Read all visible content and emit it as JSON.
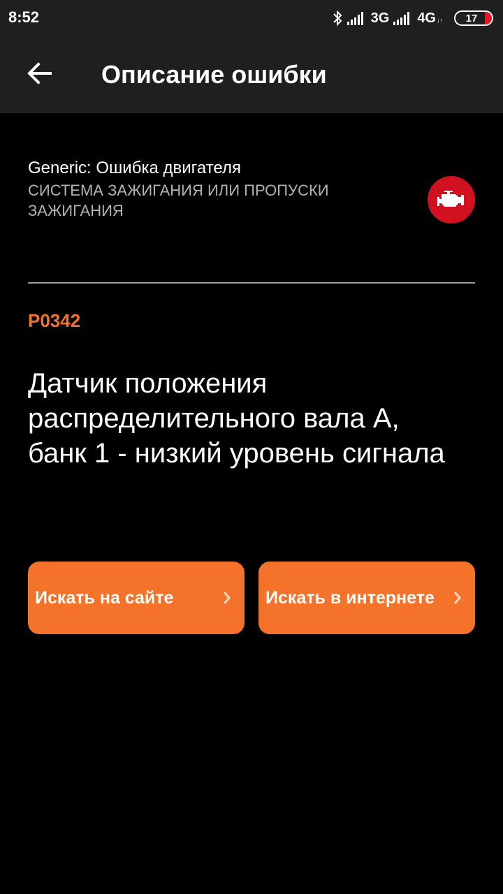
{
  "status_bar": {
    "time": "8:52",
    "network_1": "3G",
    "network_2": "4G",
    "network_2_suffix": "↓↑",
    "battery_level": "17",
    "icons": [
      "bluetooth-icon",
      "signal-icon",
      "signal-icon",
      "battery-icon"
    ]
  },
  "app_bar": {
    "title": "Описание ошибки",
    "back_icon": "arrow-left-icon"
  },
  "category": {
    "title": "Generic: Ошибка двигателя",
    "subtitle": "СИСТЕМА ЗАЖИГАНИЯ ИЛИ ПРОПУСКИ ЗАЖИГАНИЯ",
    "icon": "check-engine-icon"
  },
  "error": {
    "code": "P0342",
    "description": "Датчик положения распределительного вала A, банк 1 - низкий уровень сигнала"
  },
  "buttons": {
    "search_site": "Искать на сайте",
    "search_internet": "Искать в интернете"
  },
  "colors": {
    "accent": "#f5722a",
    "badge_red": "#d1111f",
    "bar_bg": "#1f1f1f",
    "background": "#000000"
  }
}
